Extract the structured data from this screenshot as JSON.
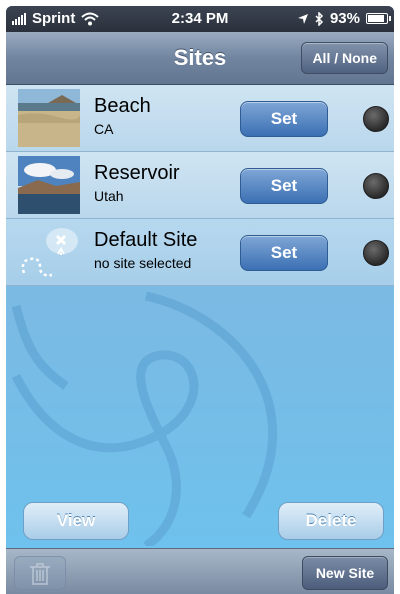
{
  "status_bar": {
    "carrier": "Sprint",
    "time": "2:34 PM",
    "battery": "93%",
    "battery_level": 0.93,
    "icons": [
      "signal-bars-icon",
      "wifi-icon",
      "location-arrow-icon",
      "bluetooth-icon",
      "battery-icon"
    ]
  },
  "nav": {
    "title": "Sites",
    "all_none_label": "All / None"
  },
  "sites": [
    {
      "name": "Beach",
      "subtitle": "CA",
      "set_label": "Set",
      "thumbnail": "beach-photo"
    },
    {
      "name": "Reservoir",
      "subtitle": "Utah",
      "set_label": "Set",
      "thumbnail": "reservoir-photo"
    },
    {
      "name": "Default Site",
      "subtitle": "no site selected",
      "set_label": "Set",
      "thumbnail": "treasure-map-icon"
    }
  ],
  "actions": {
    "view_label": "View",
    "delete_label": "Delete"
  },
  "toolbar": {
    "trash_icon": "trash-icon",
    "new_site_label": "New Site"
  },
  "colors": {
    "background": "#7cb9e2",
    "set_button": "#4a7fc1",
    "nav_bar": "#7185a0"
  }
}
